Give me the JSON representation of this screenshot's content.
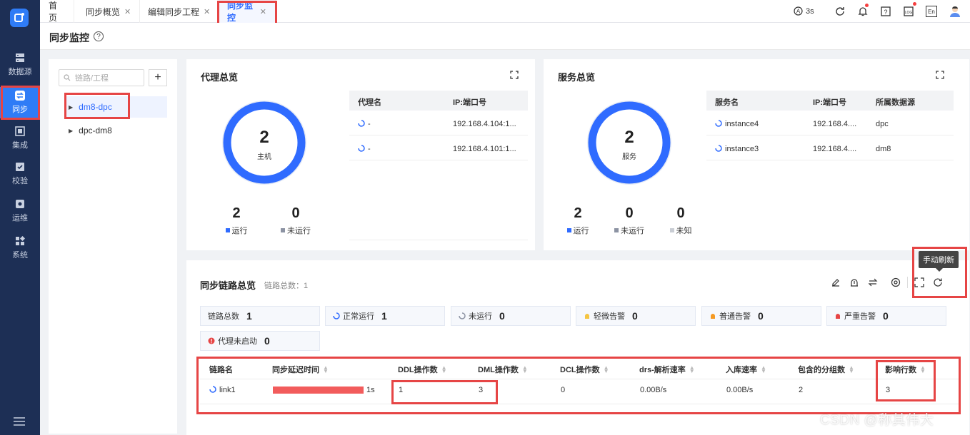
{
  "sidebar": {
    "items": [
      {
        "label": "数据源",
        "icon": "database-icon"
      },
      {
        "label": "同步",
        "icon": "sync-icon"
      },
      {
        "label": "集成",
        "icon": "integration-icon"
      },
      {
        "label": "校验",
        "icon": "check-icon"
      },
      {
        "label": "运维",
        "icon": "ops-icon"
      },
      {
        "label": "系统",
        "icon": "apps-icon"
      }
    ],
    "active": "同步"
  },
  "tabs": [
    {
      "label": "首页"
    },
    {
      "label": "同步概览"
    },
    {
      "label": "编辑同步工程"
    },
    {
      "label": "同步监控"
    }
  ],
  "header": {
    "refresh_interval": "3s",
    "lang": "En"
  },
  "page": {
    "title": "同步监控"
  },
  "tree": {
    "search_placeholder": "链路/工程",
    "items": [
      {
        "label": "dm8-dpc"
      },
      {
        "label": "dpc-dm8"
      }
    ]
  },
  "agent_overview": {
    "title": "代理总览",
    "total": "2",
    "total_label": "主机",
    "stats": [
      {
        "value": "2",
        "label": "运行",
        "color": "#2f6bff"
      },
      {
        "value": "0",
        "label": "未运行",
        "color": "#8c93a3"
      }
    ],
    "columns": [
      "代理名",
      "IP:端口号"
    ],
    "rows": [
      [
        "-",
        "192.168.4.104:1..."
      ],
      [
        "-",
        "192.168.4.101:1..."
      ]
    ]
  },
  "service_overview": {
    "title": "服务总览",
    "total": "2",
    "total_label": "服务",
    "stats": [
      {
        "value": "2",
        "label": "运行",
        "color": "#2f6bff"
      },
      {
        "value": "0",
        "label": "未运行",
        "color": "#8c93a3"
      },
      {
        "value": "0",
        "label": "未知",
        "color": "#c9cdd4"
      }
    ],
    "columns": [
      "服务名",
      "IP:端口号",
      "所属数据源"
    ],
    "rows": [
      [
        "instance4",
        "192.168.4....",
        "dpc"
      ],
      [
        "instance3",
        "192.168.4....",
        "dm8"
      ]
    ]
  },
  "link_overview": {
    "title": "同步链路总览",
    "subtitle": "链路总数：1",
    "tooltip": "手动刷新",
    "badges": [
      {
        "label": "链路总数",
        "value": "1"
      },
      {
        "label": "正常运行",
        "value": "1"
      },
      {
        "label": "未运行",
        "value": "0"
      },
      {
        "label": "轻微告警",
        "value": "0"
      },
      {
        "label": "普通告警",
        "value": "0"
      },
      {
        "label": "严重告警",
        "value": "0"
      },
      {
        "label": "代理未启动",
        "value": "0"
      }
    ],
    "columns": [
      "链路名",
      "同步延迟时间",
      "DDL操作数",
      "DML操作数",
      "DCL操作数",
      "drs-解析速率",
      "入库速率",
      "包含的分组数",
      "影响行数"
    ],
    "rows": [
      {
        "name": "link1",
        "delay": "1s",
        "delay_fraction": 1.0,
        "ddl": "1",
        "dml": "3",
        "dcl": "0",
        "parse_rate": "0.00B/s",
        "load_rate": "0.00B/s",
        "groups": "2",
        "rows_affected": "3"
      }
    ]
  },
  "watermark": "CSDN @称其伟大",
  "colors": {
    "accent": "#2f6bff",
    "sidebar": "#1d2f55",
    "highlight": "#e64545",
    "delay_bar": "#f25c5c"
  }
}
